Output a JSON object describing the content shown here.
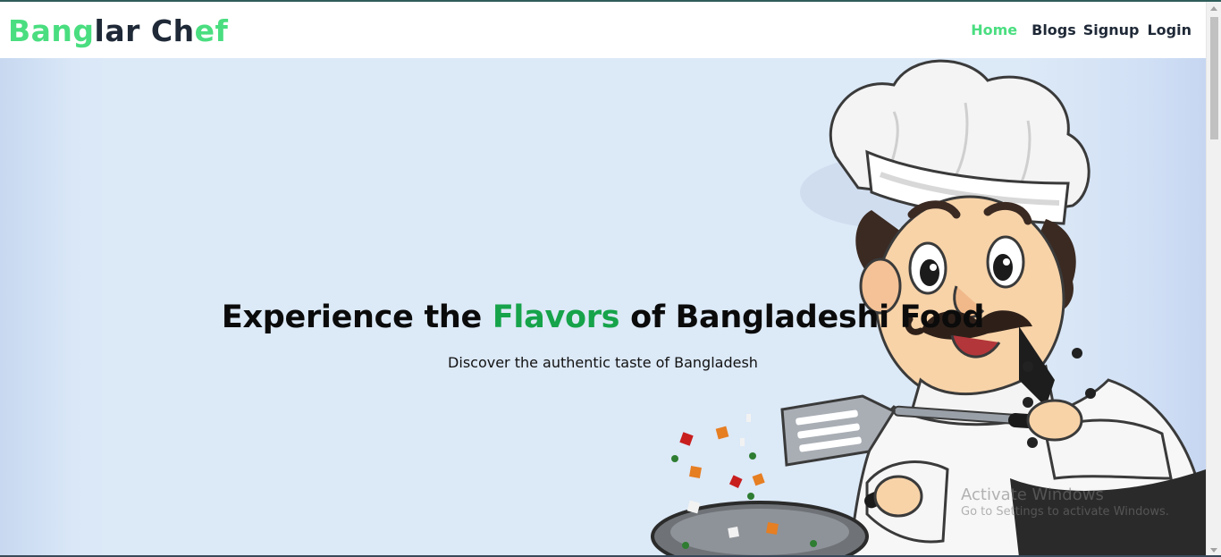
{
  "navbar": {
    "brand_parts": [
      "Bang",
      "lar",
      " Ch",
      "ef"
    ],
    "links": {
      "home": "Home",
      "blogs": "Blogs",
      "signup": "Signup",
      "login": "Login"
    }
  },
  "hero": {
    "title_pre": "Experience the ",
    "title_accent": "Flavors",
    "title_post": " of Bangladeshi Food",
    "subtitle": "Discover the authentic taste of Bangladesh",
    "illustration_icon": "chef-cooking-illustration"
  },
  "watermark": {
    "title": "Activate Windows",
    "subtitle": "Go to Settings to activate Windows."
  },
  "colors": {
    "brand_green": "#4ade80",
    "accent_green": "#16a34a",
    "text_dark": "#1f2937",
    "hero_bg": "#dce9f7"
  }
}
